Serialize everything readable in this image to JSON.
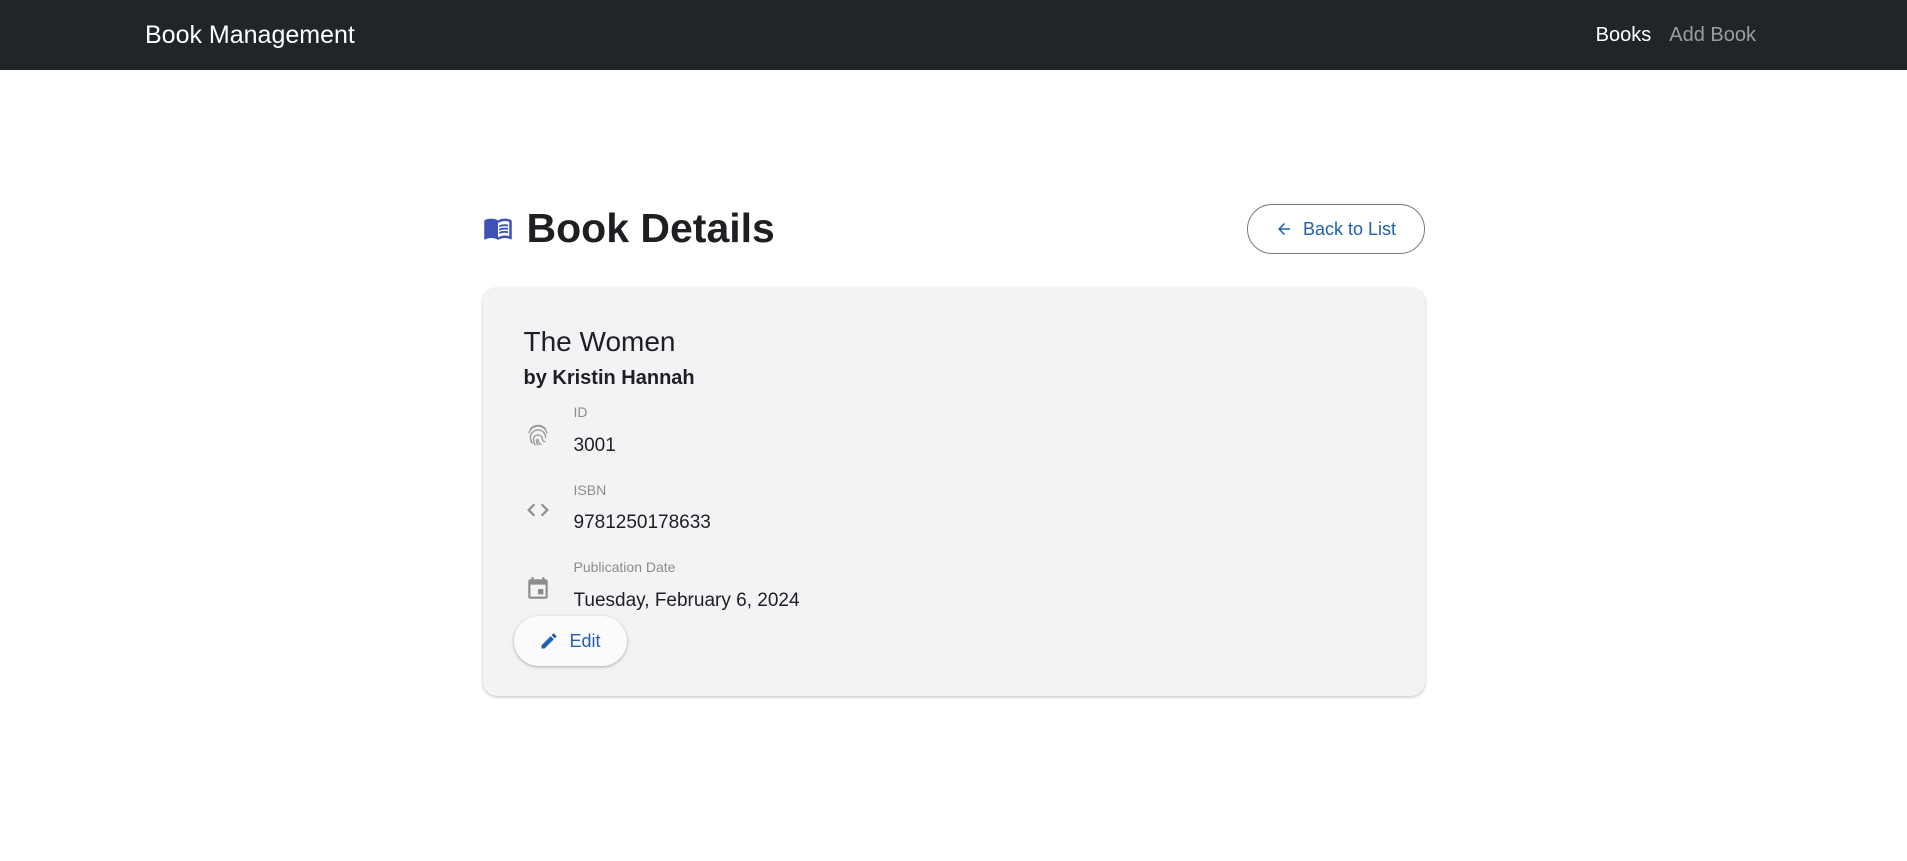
{
  "navbar": {
    "brand": "Book Management",
    "links": [
      {
        "label": "Books",
        "active": true
      },
      {
        "label": "Add Book",
        "active": false
      }
    ]
  },
  "page": {
    "title": "Book Details",
    "title_icon": "book-open-icon",
    "back_button": {
      "label": "Back to List",
      "icon": "arrow-left-icon"
    }
  },
  "book": {
    "title": "The Women",
    "author": "by Kristin Hannah",
    "fields": [
      {
        "icon": "fingerprint-icon",
        "label": "ID",
        "value": "3001"
      },
      {
        "icon": "code-icon",
        "label": "ISBN",
        "value": "9781250178633"
      },
      {
        "icon": "calendar-icon",
        "label": "Publication Date",
        "value": "Tuesday, February 6, 2024"
      }
    ]
  },
  "actions": {
    "edit_label": "Edit",
    "edit_icon": "pencil-icon"
  },
  "colors": {
    "navbar_bg": "#212529",
    "primary": "#1f5fae",
    "title_icon": "#3f51b5",
    "card_bg": "#f3f3f5",
    "muted_icon": "#8c8c8c"
  }
}
